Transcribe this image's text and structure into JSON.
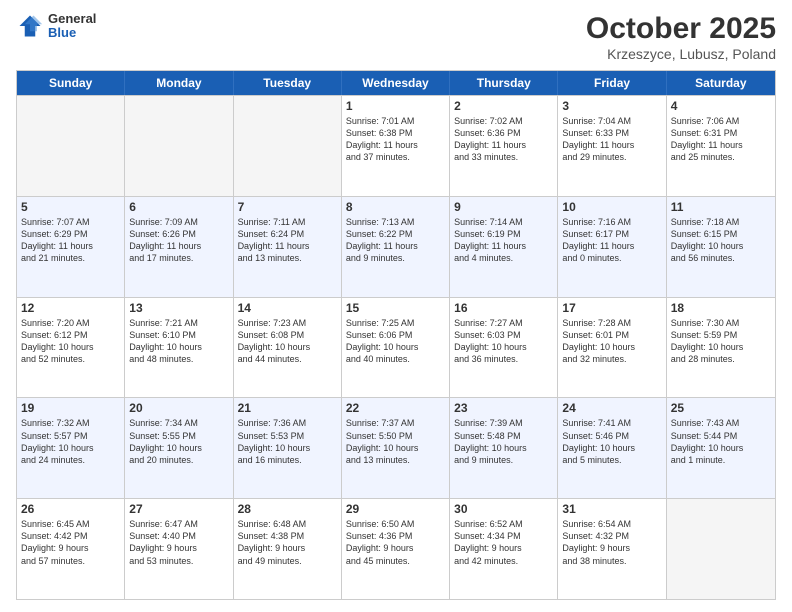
{
  "header": {
    "logo_general": "General",
    "logo_blue": "Blue",
    "month_title": "October 2025",
    "subtitle": "Krzeszyce, Lubusz, Poland"
  },
  "weekdays": [
    "Sunday",
    "Monday",
    "Tuesday",
    "Wednesday",
    "Thursday",
    "Friday",
    "Saturday"
  ],
  "rows": [
    [
      {
        "day": "",
        "lines": []
      },
      {
        "day": "",
        "lines": []
      },
      {
        "day": "",
        "lines": []
      },
      {
        "day": "1",
        "lines": [
          "Sunrise: 7:01 AM",
          "Sunset: 6:38 PM",
          "Daylight: 11 hours",
          "and 37 minutes."
        ]
      },
      {
        "day": "2",
        "lines": [
          "Sunrise: 7:02 AM",
          "Sunset: 6:36 PM",
          "Daylight: 11 hours",
          "and 33 minutes."
        ]
      },
      {
        "day": "3",
        "lines": [
          "Sunrise: 7:04 AM",
          "Sunset: 6:33 PM",
          "Daylight: 11 hours",
          "and 29 minutes."
        ]
      },
      {
        "day": "4",
        "lines": [
          "Sunrise: 7:06 AM",
          "Sunset: 6:31 PM",
          "Daylight: 11 hours",
          "and 25 minutes."
        ]
      }
    ],
    [
      {
        "day": "5",
        "lines": [
          "Sunrise: 7:07 AM",
          "Sunset: 6:29 PM",
          "Daylight: 11 hours",
          "and 21 minutes."
        ]
      },
      {
        "day": "6",
        "lines": [
          "Sunrise: 7:09 AM",
          "Sunset: 6:26 PM",
          "Daylight: 11 hours",
          "and 17 minutes."
        ]
      },
      {
        "day": "7",
        "lines": [
          "Sunrise: 7:11 AM",
          "Sunset: 6:24 PM",
          "Daylight: 11 hours",
          "and 13 minutes."
        ]
      },
      {
        "day": "8",
        "lines": [
          "Sunrise: 7:13 AM",
          "Sunset: 6:22 PM",
          "Daylight: 11 hours",
          "and 9 minutes."
        ]
      },
      {
        "day": "9",
        "lines": [
          "Sunrise: 7:14 AM",
          "Sunset: 6:19 PM",
          "Daylight: 11 hours",
          "and 4 minutes."
        ]
      },
      {
        "day": "10",
        "lines": [
          "Sunrise: 7:16 AM",
          "Sunset: 6:17 PM",
          "Daylight: 11 hours",
          "and 0 minutes."
        ]
      },
      {
        "day": "11",
        "lines": [
          "Sunrise: 7:18 AM",
          "Sunset: 6:15 PM",
          "Daylight: 10 hours",
          "and 56 minutes."
        ]
      }
    ],
    [
      {
        "day": "12",
        "lines": [
          "Sunrise: 7:20 AM",
          "Sunset: 6:12 PM",
          "Daylight: 10 hours",
          "and 52 minutes."
        ]
      },
      {
        "day": "13",
        "lines": [
          "Sunrise: 7:21 AM",
          "Sunset: 6:10 PM",
          "Daylight: 10 hours",
          "and 48 minutes."
        ]
      },
      {
        "day": "14",
        "lines": [
          "Sunrise: 7:23 AM",
          "Sunset: 6:08 PM",
          "Daylight: 10 hours",
          "and 44 minutes."
        ]
      },
      {
        "day": "15",
        "lines": [
          "Sunrise: 7:25 AM",
          "Sunset: 6:06 PM",
          "Daylight: 10 hours",
          "and 40 minutes."
        ]
      },
      {
        "day": "16",
        "lines": [
          "Sunrise: 7:27 AM",
          "Sunset: 6:03 PM",
          "Daylight: 10 hours",
          "and 36 minutes."
        ]
      },
      {
        "day": "17",
        "lines": [
          "Sunrise: 7:28 AM",
          "Sunset: 6:01 PM",
          "Daylight: 10 hours",
          "and 32 minutes."
        ]
      },
      {
        "day": "18",
        "lines": [
          "Sunrise: 7:30 AM",
          "Sunset: 5:59 PM",
          "Daylight: 10 hours",
          "and 28 minutes."
        ]
      }
    ],
    [
      {
        "day": "19",
        "lines": [
          "Sunrise: 7:32 AM",
          "Sunset: 5:57 PM",
          "Daylight: 10 hours",
          "and 24 minutes."
        ]
      },
      {
        "day": "20",
        "lines": [
          "Sunrise: 7:34 AM",
          "Sunset: 5:55 PM",
          "Daylight: 10 hours",
          "and 20 minutes."
        ]
      },
      {
        "day": "21",
        "lines": [
          "Sunrise: 7:36 AM",
          "Sunset: 5:53 PM",
          "Daylight: 10 hours",
          "and 16 minutes."
        ]
      },
      {
        "day": "22",
        "lines": [
          "Sunrise: 7:37 AM",
          "Sunset: 5:50 PM",
          "Daylight: 10 hours",
          "and 13 minutes."
        ]
      },
      {
        "day": "23",
        "lines": [
          "Sunrise: 7:39 AM",
          "Sunset: 5:48 PM",
          "Daylight: 10 hours",
          "and 9 minutes."
        ]
      },
      {
        "day": "24",
        "lines": [
          "Sunrise: 7:41 AM",
          "Sunset: 5:46 PM",
          "Daylight: 10 hours",
          "and 5 minutes."
        ]
      },
      {
        "day": "25",
        "lines": [
          "Sunrise: 7:43 AM",
          "Sunset: 5:44 PM",
          "Daylight: 10 hours",
          "and 1 minute."
        ]
      }
    ],
    [
      {
        "day": "26",
        "lines": [
          "Sunrise: 6:45 AM",
          "Sunset: 4:42 PM",
          "Daylight: 9 hours",
          "and 57 minutes."
        ]
      },
      {
        "day": "27",
        "lines": [
          "Sunrise: 6:47 AM",
          "Sunset: 4:40 PM",
          "Daylight: 9 hours",
          "and 53 minutes."
        ]
      },
      {
        "day": "28",
        "lines": [
          "Sunrise: 6:48 AM",
          "Sunset: 4:38 PM",
          "Daylight: 9 hours",
          "and 49 minutes."
        ]
      },
      {
        "day": "29",
        "lines": [
          "Sunrise: 6:50 AM",
          "Sunset: 4:36 PM",
          "Daylight: 9 hours",
          "and 45 minutes."
        ]
      },
      {
        "day": "30",
        "lines": [
          "Sunrise: 6:52 AM",
          "Sunset: 4:34 PM",
          "Daylight: 9 hours",
          "and 42 minutes."
        ]
      },
      {
        "day": "31",
        "lines": [
          "Sunrise: 6:54 AM",
          "Sunset: 4:32 PM",
          "Daylight: 9 hours",
          "and 38 minutes."
        ]
      },
      {
        "day": "",
        "lines": []
      }
    ]
  ]
}
